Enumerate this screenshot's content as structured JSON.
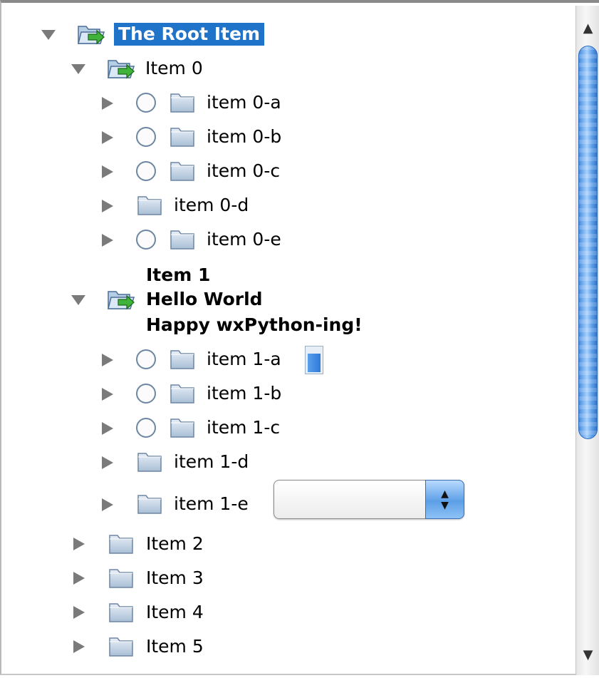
{
  "tree": {
    "root": {
      "label": "The Root Item"
    },
    "item0": {
      "label": "Item 0",
      "children": [
        {
          "label": "item 0-a"
        },
        {
          "label": "item 0-b"
        },
        {
          "label": "item 0-c"
        },
        {
          "label": "item 0-d"
        },
        {
          "label": "item 0-e"
        }
      ]
    },
    "item1": {
      "line1": "Item 1",
      "line2": "Hello World",
      "line3": "Happy wxPython-ing!",
      "children": [
        {
          "label": "item 1-a"
        },
        {
          "label": "item 1-b"
        },
        {
          "label": "item 1-c"
        },
        {
          "label": "item 1-d"
        },
        {
          "label": "item 1-e"
        }
      ]
    },
    "collapsed": [
      {
        "label": "Item 2"
      },
      {
        "label": "Item 3"
      },
      {
        "label": "Item 4"
      },
      {
        "label": "Item 5"
      }
    ]
  },
  "gauge": {
    "level": 0.75
  },
  "combo": {
    "value": ""
  },
  "icons": {
    "expanded": "triangle-down-icon",
    "collapsed": "triangle-right-icon",
    "open_folder": "folder-open-arrow-icon",
    "folder": "folder-icon",
    "radio": "radio-button-icon"
  },
  "colors": {
    "selection": "#1f73c9",
    "scroll_thumb": "#4a90e2"
  }
}
